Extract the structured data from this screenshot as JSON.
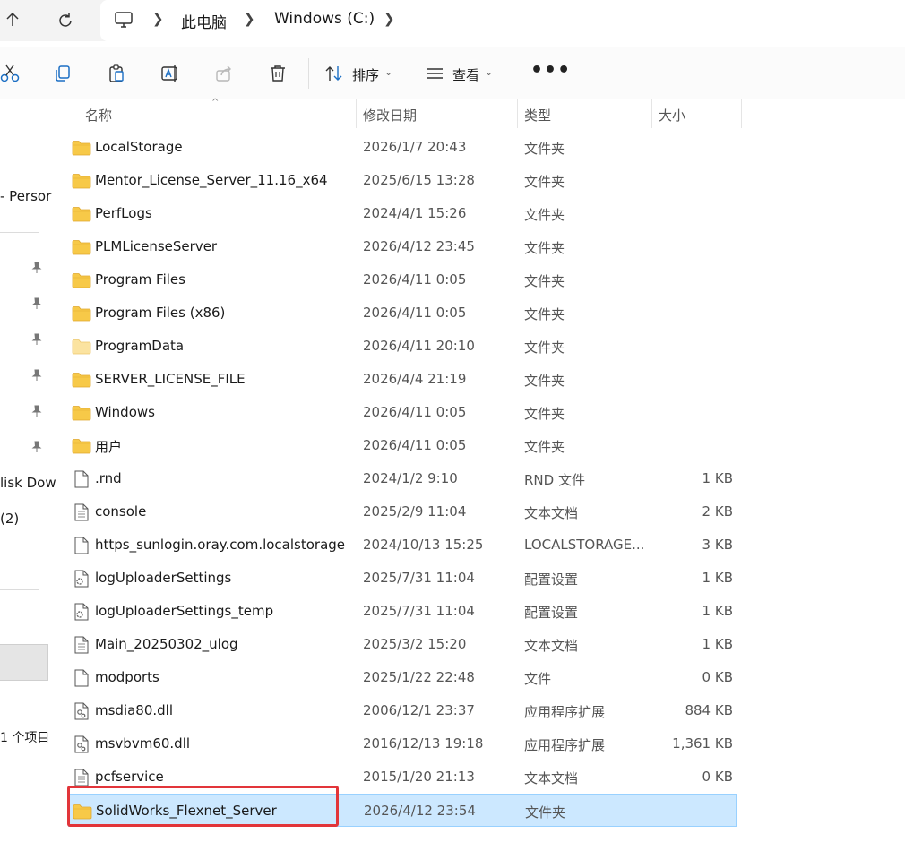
{
  "address": {
    "crumbs": [
      "此电脑",
      "Windows (C:)"
    ]
  },
  "toolbar": {
    "sort_label": "排序",
    "view_label": "查看",
    "more_label": "•••"
  },
  "sidebar": {
    "texts": [
      "- Persor",
      "lisk Dow",
      "(2)"
    ],
    "status": "1 个项目"
  },
  "columns": {
    "name": "名称",
    "date": "修改日期",
    "type": "类型",
    "size": "大小"
  },
  "rows": [
    {
      "name": "LocalStorage",
      "date": "2026/1/7 20:43",
      "type": "文件夹",
      "size": "",
      "icon": "folder-icon"
    },
    {
      "name": "Mentor_License_Server_11.16_x64",
      "date": "2025/6/15 13:28",
      "type": "文件夹",
      "size": "",
      "icon": "folder-icon"
    },
    {
      "name": "PerfLogs",
      "date": "2024/4/1 15:26",
      "type": "文件夹",
      "size": "",
      "icon": "folder-icon"
    },
    {
      "name": "PLMLicenseServer",
      "date": "2026/4/12 23:45",
      "type": "文件夹",
      "size": "",
      "icon": "folder-icon"
    },
    {
      "name": "Program Files",
      "date": "2026/4/11 0:05",
      "type": "文件夹",
      "size": "",
      "icon": "folder-icon"
    },
    {
      "name": "Program Files (x86)",
      "date": "2026/4/11 0:05",
      "type": "文件夹",
      "size": "",
      "icon": "folder-icon"
    },
    {
      "name": "ProgramData",
      "date": "2026/4/11 20:10",
      "type": "文件夹",
      "size": "",
      "icon": "folder-light-icon"
    },
    {
      "name": "SERVER_LICENSE_FILE",
      "date": "2026/4/4 21:19",
      "type": "文件夹",
      "size": "",
      "icon": "folder-icon"
    },
    {
      "name": "Windows",
      "date": "2026/4/11 0:05",
      "type": "文件夹",
      "size": "",
      "icon": "folder-icon"
    },
    {
      "name": "用户",
      "date": "2026/4/11 0:05",
      "type": "文件夹",
      "size": "",
      "icon": "folder-icon"
    },
    {
      "name": ".rnd",
      "date": "2024/1/2 9:10",
      "type": "RND 文件",
      "size": "1 KB",
      "icon": "blank-file-icon"
    },
    {
      "name": "console",
      "date": "2025/2/9 11:04",
      "type": "文本文档",
      "size": "2 KB",
      "icon": "text-file-icon"
    },
    {
      "name": "https_sunlogin.oray.com.localstorage",
      "date": "2024/10/13 15:25",
      "type": "LOCALSTORAGE...",
      "size": "3 KB",
      "icon": "blank-file-icon"
    },
    {
      "name": "logUploaderSettings",
      "date": "2025/7/31 11:04",
      "type": "配置设置",
      "size": "1 KB",
      "icon": "settings-file-icon"
    },
    {
      "name": "logUploaderSettings_temp",
      "date": "2025/7/31 11:04",
      "type": "配置设置",
      "size": "1 KB",
      "icon": "settings-file-icon"
    },
    {
      "name": "Main_20250302_ulog",
      "date": "2025/3/2 15:20",
      "type": "文本文档",
      "size": "1 KB",
      "icon": "text-file-icon"
    },
    {
      "name": "modports",
      "date": "2025/1/22 22:48",
      "type": "文件",
      "size": "0 KB",
      "icon": "blank-file-icon"
    },
    {
      "name": "msdia80.dll",
      "date": "2006/12/1 23:37",
      "type": "应用程序扩展",
      "size": "884 KB",
      "icon": "dll-file-icon"
    },
    {
      "name": "msvbvm60.dll",
      "date": "2016/12/13 19:18",
      "type": "应用程序扩展",
      "size": "1,361 KB",
      "icon": "dll-file-icon"
    },
    {
      "name": "pcfservice",
      "date": "2015/1/20 21:13",
      "type": "文本文档",
      "size": "0 KB",
      "icon": "text-file-icon"
    },
    {
      "name": "SolidWorks_Flexnet_Server",
      "date": "2026/4/12 23:54",
      "type": "文件夹",
      "size": "",
      "icon": "folder-icon",
      "selected": true
    }
  ],
  "colors": {
    "selection_bg": "#cce8ff",
    "selection_border": "#99d1ff",
    "highlight": "#e2353a",
    "folder": "#f7c948"
  }
}
